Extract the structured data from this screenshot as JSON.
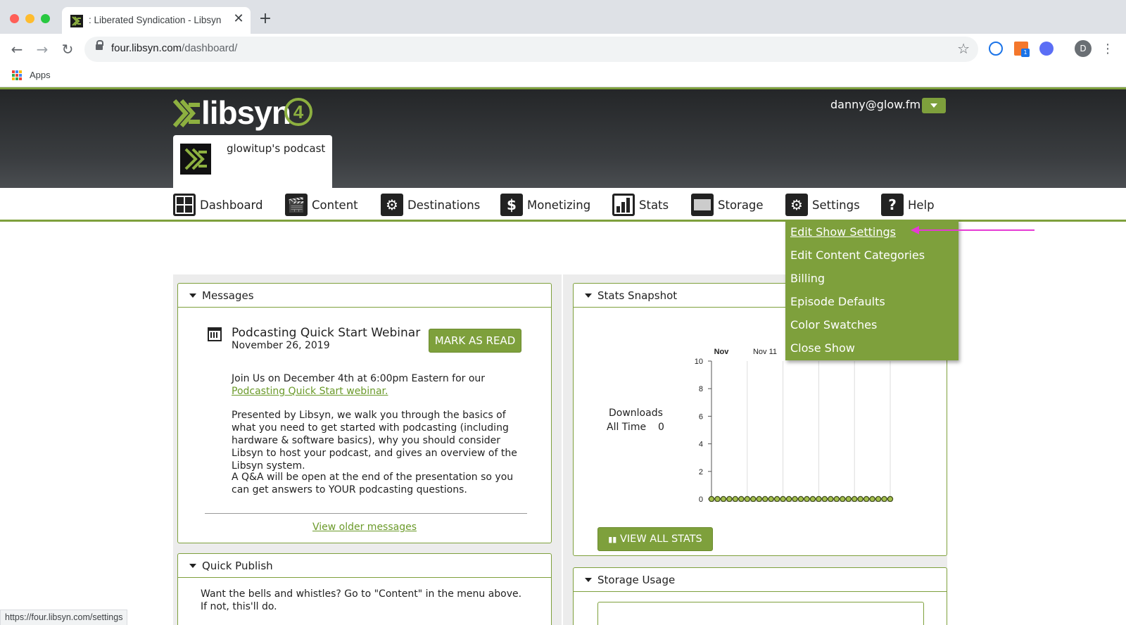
{
  "browser": {
    "tab_title": ": Liberated Syndication - Libsyn",
    "url_host": "four.libsyn.com",
    "url_path": "/dashboard/",
    "bookmarks_apps": "Apps",
    "profile_initial": "D",
    "ext_badge": "1",
    "status_url": "https://four.libsyn.com/settings"
  },
  "header": {
    "logo_text": "libsyn",
    "logo_number": "4",
    "user_email": "danny@glow.fm",
    "show_name": "glowitup's podcast"
  },
  "nav": {
    "items": [
      {
        "label": "Dashboard",
        "icon": "dashboard-icon"
      },
      {
        "label": "Content",
        "icon": "content-icon"
      },
      {
        "label": "Destinations",
        "icon": "destinations-icon"
      },
      {
        "label": "Monetizing",
        "icon": "dollar-icon"
      },
      {
        "label": "Stats",
        "icon": "stats-icon"
      },
      {
        "label": "Storage",
        "icon": "storage-icon"
      },
      {
        "label": "Settings",
        "icon": "gears-icon"
      },
      {
        "label": "Help",
        "icon": "help-icon"
      }
    ]
  },
  "settings_menu": {
    "items": [
      "Edit Show Settings",
      "Edit Content Categories",
      "Billing",
      "Episode Defaults",
      "Color Swatches",
      "Close Show"
    ]
  },
  "messages": {
    "title": "Messages",
    "item_title": "Podcasting Quick Start Webinar",
    "item_date": "November 26, 2019",
    "mark_read": "MARK AS READ",
    "p1_text": "Join Us on December 4th at 6:00pm Eastern for our",
    "p1_link": "Podcasting Quick Start webinar.",
    "p2": "Presented by Libsyn, we walk you through the basics of what you need to get started with podcasting (including hardware & software basics), why you should consider Libsyn to host your podcast, and gives an overview of the Libsyn system.",
    "p3": "A Q&A will be open at the end of the presentation so you can get answers to YOUR podcasting questions.",
    "older_link": "View older messages"
  },
  "quick_publish": {
    "title": "Quick Publish",
    "text": "Want the bells and whistles? Go to \"Content\" in the menu above. If not, this'll do."
  },
  "stats": {
    "title": "Stats Snapshot",
    "downloads_label": "Downloads",
    "all_time_label": "All Time",
    "all_time_value": "0",
    "view_all": "VIEW ALL STATS"
  },
  "storage": {
    "title": "Storage Usage"
  },
  "chart_data": {
    "type": "line",
    "x_tick_labels": [
      "Nov",
      "Nov 11"
    ],
    "y_ticks": [
      0,
      2,
      4,
      6,
      8,
      10
    ],
    "ylim": [
      0,
      10
    ],
    "series": [
      {
        "values": [
          0,
          0,
          0,
          0,
          0,
          0,
          0,
          0,
          0,
          0,
          0,
          0,
          0,
          0,
          0,
          0,
          0,
          0,
          0,
          0,
          0,
          0,
          0,
          0,
          0,
          0,
          0,
          0,
          0,
          0,
          0
        ]
      }
    ],
    "marker_color": "#3d4a1a",
    "grid": true
  }
}
